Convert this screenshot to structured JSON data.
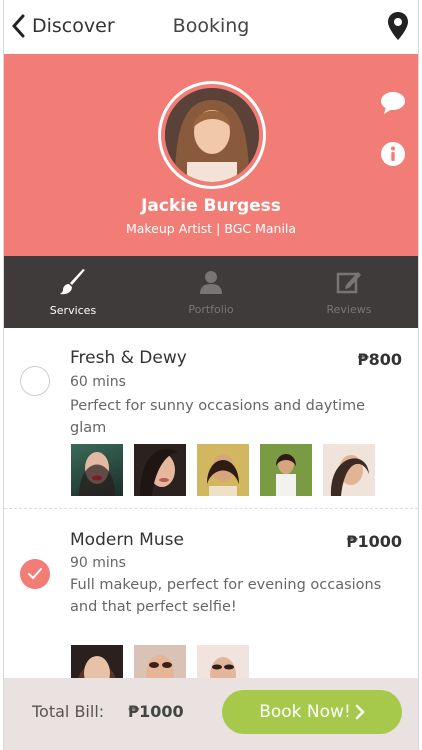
{
  "header": {
    "back_label": "Discover",
    "title": "Booking",
    "back_icon": "chevron-left-icon",
    "location_icon": "map-pin-icon"
  },
  "profile": {
    "name": "Jackie Burgess",
    "subtitle": "Makeup Artist | BGC Manila",
    "accent_color": "#f17d76",
    "side_icons": [
      "chat-bubble-icon",
      "info-icon"
    ]
  },
  "tabs": [
    {
      "label": "Services",
      "icon": "brush-icon",
      "active": true
    },
    {
      "label": "Portfolio",
      "icon": "person-icon",
      "active": false
    },
    {
      "label": "Reviews",
      "icon": "edit-icon",
      "active": false
    }
  ],
  "services": [
    {
      "name": "Fresh & Dewy",
      "price": "₱800",
      "duration": "60 mins",
      "description": "Perfect for sunny occasions and daytime glam",
      "selected": false,
      "photo_count": 5
    },
    {
      "name": "Modern Muse",
      "price": "₱1000",
      "duration": "90 mins",
      "description": "Full makeup, perfect for evening occasions and that perfect selfie!",
      "selected": true,
      "photo_count": 3
    }
  ],
  "footer": {
    "total_label": "Total Bill:",
    "total_value": "₱1000",
    "book_label": "Book Now!",
    "book_color": "#a6c94c"
  }
}
